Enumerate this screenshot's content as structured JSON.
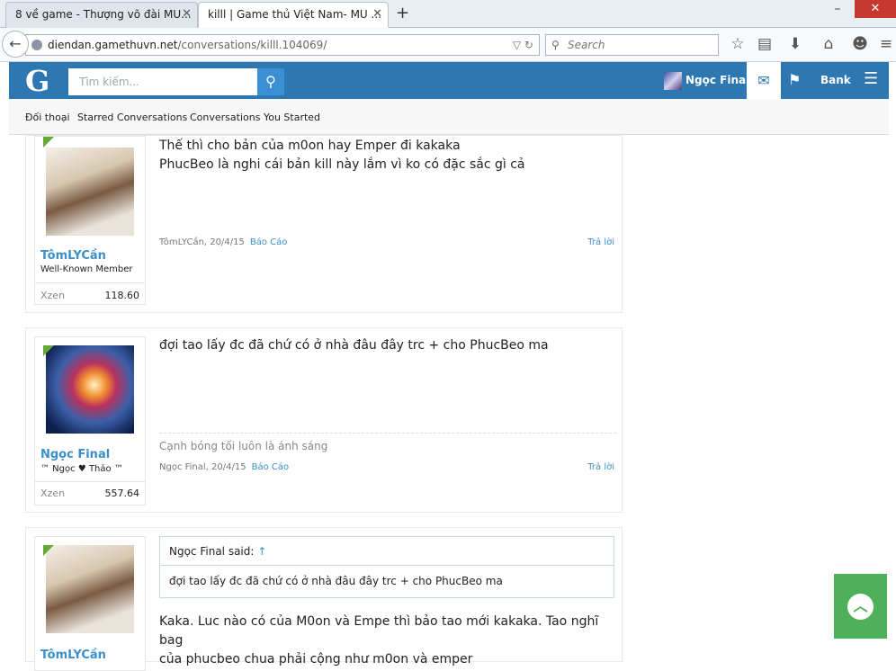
{
  "browser": {
    "tabs": [
      {
        "title": "8 về game - Thượng võ đài MU..."
      },
      {
        "title": "killl | Game thủ Việt Nam- MU ..."
      }
    ],
    "url_host": "diendan.gamethuvn.net",
    "url_path": "/conversations/killl.104069/",
    "search_placeholder": "Search",
    "icons": [
      "back-arrow-icon",
      "star-icon",
      "reader-icon",
      "download-icon",
      "home-icon",
      "smiley-icon",
      "menu-icon"
    ]
  },
  "site": {
    "logo": "G",
    "search_placeholder": "Tìm kiếm...",
    "user_name": "Ngọc Final",
    "bank_label": "Bank",
    "accent_color": "#2d77b2"
  },
  "subnav": {
    "items": [
      "Đối thoại",
      "Starred Conversations",
      "Conversations You Started"
    ]
  },
  "messages": [
    {
      "author": "TômLYCần",
      "title": "Well-Known Member",
      "stat_label": "Xzen",
      "stat_value": "118.60",
      "lines": [
        "Thế thì cho bản của m0on hay Emper đi kakaka",
        "PhucBeo là nghi cái bản kill này lắm vì ko có đặc sắc gì cả"
      ],
      "meta": "TômLYCần, 20/4/15",
      "report": "Báo Cáo",
      "reply": "Trả lời"
    },
    {
      "author": "Ngọc Final",
      "title": "™ Ngọc ♥ Thảo ™",
      "stat_label": "Xzen",
      "stat_value": "557.64",
      "lines": [
        "đợi tao lấy đc đã chứ có ở nhà đâu đây trc + cho PhucBeo ma"
      ],
      "signature": "Cạnh bóng tối luôn là ánh sáng",
      "meta": "Ngọc Final, 20/4/15",
      "report": "Báo Cáo",
      "reply": "Trả lời"
    },
    {
      "author": "TômLYCần",
      "quote_author": "Ngọc Final said:",
      "quote_arrow": "↑",
      "quote_text": "đợi tao lấy đc đã chứ có ở nhà đâu đây trc + cho PhucBeo ma",
      "lines": [
        "Kaka. Luc nào có của M0on và Empe thì bảo tao mới kakaka. Tao nghĩ bag",
        "của phucbeo chua phải cộng như m0on và emper"
      ]
    }
  ]
}
